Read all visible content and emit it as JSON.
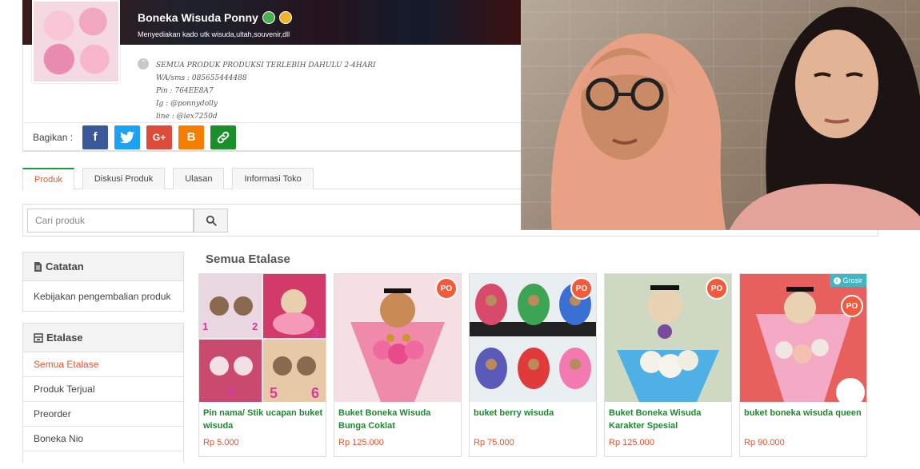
{
  "shop": {
    "name": "Boneka Wisuda Ponny",
    "tagline": "Menyediakan kado utk wisuda,ultah,souvenir,dll",
    "description_lines": [
      "SEMUA PRODUK PRODUKSI TERLEBIH DAHULU 2-4HARI",
      "WA/sms : 085655444488",
      "Pin : 764EE8A7",
      "Ig : @ponnydolly",
      "line : @iex7250d"
    ]
  },
  "share": {
    "label": "Bagikan :",
    "buttons": [
      {
        "icon": "facebook-icon",
        "glyph": "f"
      },
      {
        "icon": "twitter-icon",
        "glyph": "t"
      },
      {
        "icon": "google-plus-icon",
        "glyph": "G+"
      },
      {
        "icon": "blogger-icon",
        "glyph": "B"
      },
      {
        "icon": "link-icon",
        "glyph": "🔗"
      }
    ]
  },
  "tabs": [
    {
      "label": "Produk",
      "active": true
    },
    {
      "label": "Diskusi Produk",
      "active": false
    },
    {
      "label": "Ulasan",
      "active": false
    },
    {
      "label": "Informasi Toko",
      "active": false
    }
  ],
  "search": {
    "placeholder": "Cari produk"
  },
  "sidebar": {
    "catatan": {
      "title": "Catatan",
      "items": [
        "Kebijakan pengembalian produk"
      ]
    },
    "etalase": {
      "title": "Etalase",
      "items": [
        "Semua Etalase",
        "Produk Terjual",
        "Preorder",
        "Boneka Nio"
      ]
    }
  },
  "products": {
    "section_title": "Semua Etalase",
    "items": [
      {
        "name": "Pin nama/ Stik ucapan buket wisuda",
        "price": "Rp 5.000",
        "po": false,
        "grosir": false
      },
      {
        "name": "Buket Boneka Wisuda Bunga Coklat",
        "price": "Rp 125.000",
        "po": true,
        "grosir": false
      },
      {
        "name": "buket berry wisuda",
        "price": "Rp 75.000",
        "po": true,
        "grosir": false
      },
      {
        "name": "Buket Boneka Wisuda Karakter Spesial",
        "price": "Rp 125.000",
        "po": true,
        "grosir": false
      },
      {
        "name": "buket boneka wisuda queen",
        "price": "Rp 90.000",
        "po": true,
        "grosir": true
      }
    ],
    "po_label": "PO",
    "grosir_label": "Grosir"
  }
}
